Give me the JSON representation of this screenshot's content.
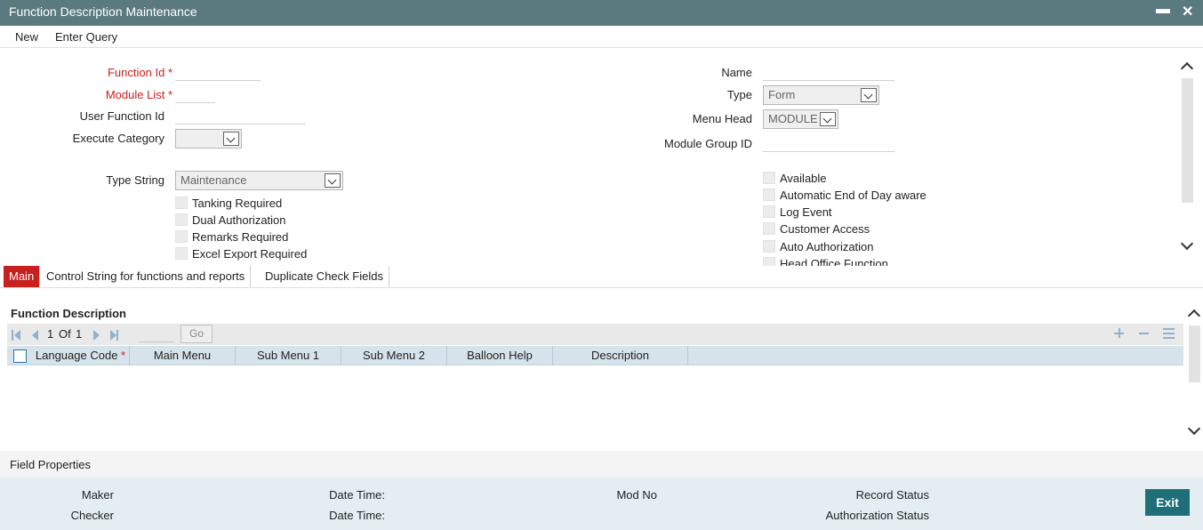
{
  "window": {
    "title": "Function Description Maintenance",
    "minimize_glyph": "▬",
    "close_glyph": "✕"
  },
  "menu": {
    "new_label": "New",
    "enter_query_label": "Enter Query"
  },
  "form": {
    "function_id_label": "Function Id",
    "module_list_label": "Module List",
    "required_mark": "*",
    "user_function_id_label": "User Function Id",
    "execute_category_label": "Execute Category",
    "execute_category_value": "",
    "type_string_label": "Type String",
    "type_string_value": "Maintenance",
    "name_label": "Name",
    "type_label": "Type",
    "type_value": "Form",
    "menu_head_label": "Menu Head",
    "menu_head_value": "MODULE",
    "module_group_id_label": "Module Group ID",
    "left_checkboxes": [
      "Tanking Required",
      "Dual Authorization",
      "Remarks Required",
      "Excel Export Required"
    ],
    "right_checkboxes": [
      "Available",
      "Automatic End of Day aware",
      "Log Event",
      "Customer Access",
      "Auto Authorization",
      "Head Office Function"
    ]
  },
  "tabs": [
    {
      "label": "Main",
      "active": true
    },
    {
      "label": "Control String for functions and reports",
      "active": false
    },
    {
      "label": "Duplicate Check Fields",
      "active": false
    }
  ],
  "function_description": {
    "title": "Function Description",
    "pager": {
      "current": "1",
      "of_label": "Of",
      "total": "1",
      "go_label": "Go"
    },
    "columns": [
      "Language Code",
      "Main Menu",
      "Sub Menu 1",
      "Sub Menu 2",
      "Balloon Help",
      "Description"
    ],
    "required_mark": "*"
  },
  "field_properties_label": "Field Properties",
  "footer": {
    "maker_label": "Maker",
    "checker_label": "Checker",
    "date_time_label_1": "Date Time:",
    "date_time_label_2": "Date Time:",
    "mod_no_label": "Mod No",
    "record_status_label": "Record Status",
    "authorization_status_label": "Authorization Status",
    "exit_label": "Exit"
  },
  "colors": {
    "titlebar": "#5a7a80",
    "required": "#c8201f",
    "active_tab": "#c8201f",
    "grid_header": "#d6e3eb",
    "footer_bg": "#e4eef2",
    "exit_button": "#1f6f79"
  }
}
